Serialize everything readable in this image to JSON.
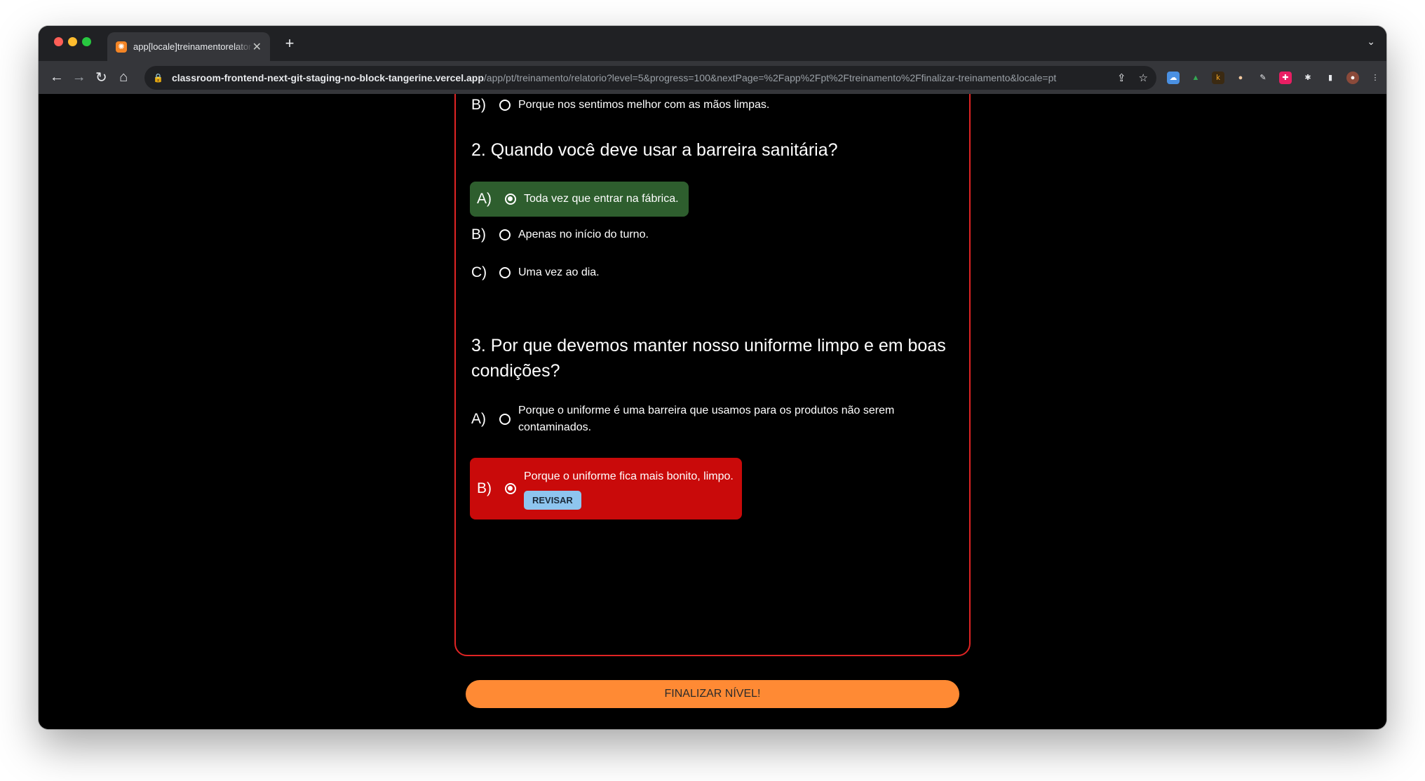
{
  "browser": {
    "tab_title": "app[locale]treinamentorelatorio",
    "tab_favicon": "✺",
    "url_host": "classroom-frontend-next-git-staging-no-block-tangerine.vercel.app",
    "url_path": "/app/pt/treinamento/relatorio?level=5&progress=100&nextPage=%2Fapp%2Fpt%2Ftreinamento%2Ffinalizar-treinamento&locale=pt"
  },
  "quiz": {
    "q1": {
      "option_b": {
        "letter": "B)",
        "text": "Porque nos sentimos melhor com as mãos limpas."
      }
    },
    "q2": {
      "question": "2. Quando você deve usar a barreira sanitária?",
      "option_a": {
        "letter": "A)",
        "text": "Toda vez que entrar na fábrica.",
        "state": "correct"
      },
      "option_b": {
        "letter": "B)",
        "text": "Apenas no início do turno."
      },
      "option_c": {
        "letter": "C)",
        "text": "Uma vez ao dia."
      }
    },
    "q3": {
      "question": "3. Por que devemos manter nosso uniforme limpo e em boas condições?",
      "option_a": {
        "letter": "A)",
        "text": "Porque o uniforme é uma barreira que usamos para os produtos não serem contaminados."
      },
      "option_b": {
        "letter": "B)",
        "text": "Porque o uniforme fica mais bonito, limpo.",
        "state": "wrong",
        "review_label": "REVISAR"
      }
    }
  },
  "finish_button": "FINALIZAR NÍVEL!",
  "colors": {
    "correct": "#2e5e2e",
    "wrong": "#c90a0a",
    "card_border": "#e02424",
    "finish": "#ff8a34",
    "review": "#8ec5ef"
  }
}
